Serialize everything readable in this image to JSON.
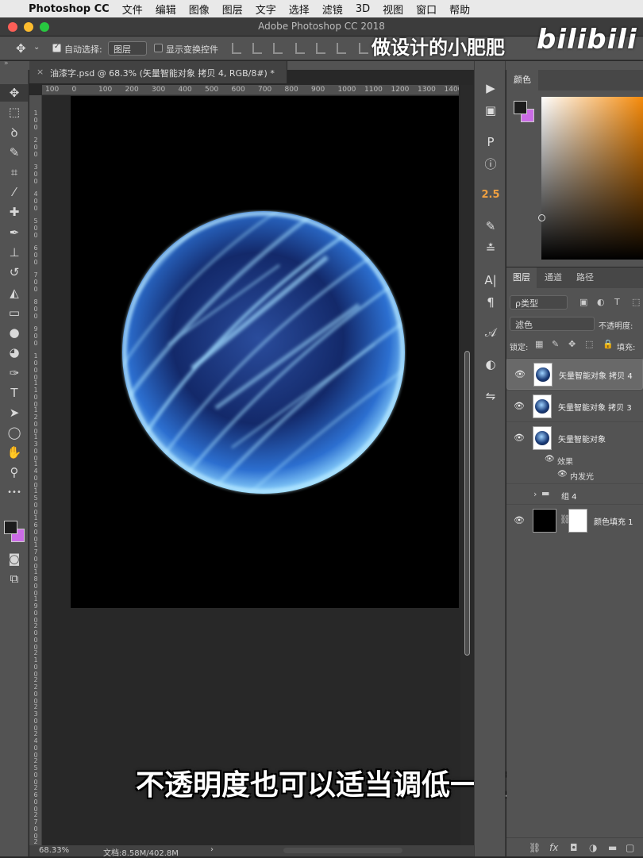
{
  "menubar": {
    "apple": "",
    "app_name": "Photoshop CC",
    "items": [
      "文件",
      "编辑",
      "图像",
      "图层",
      "文字",
      "选择",
      "滤镜",
      "3D",
      "视图",
      "窗口",
      "帮助"
    ]
  },
  "window": {
    "title": "Adobe Photoshop CC 2018"
  },
  "options_bar": {
    "auto_select_label": "自动选择:",
    "auto_select_checked": true,
    "auto_select_target": "图层",
    "show_transform_label": "显示变换控件",
    "show_transform_checked": false
  },
  "watermark": {
    "text": "做设计的小肥肥",
    "logo": "bilibili"
  },
  "document": {
    "tab_close": "×",
    "tab_title": "油漆字.psd @ 68.3% (矢量智能对象 拷贝 4, RGB/8#) *",
    "ruler_h": [
      "100",
      "0",
      "100",
      "200",
      "300",
      "400",
      "500",
      "600",
      "700",
      "800",
      "900",
      "1000",
      "1100",
      "1200",
      "1300",
      "1400"
    ],
    "ruler_v": [
      "100",
      "200",
      "300",
      "400",
      "500",
      "600",
      "700",
      "800",
      "900",
      "1000",
      "1100",
      "1200",
      "1300",
      "1400",
      "1500",
      "1600",
      "1700",
      "1800",
      "1900",
      "2000",
      "2100",
      "2200",
      "2300",
      "2400",
      "2500",
      "2600",
      "2700",
      "2800"
    ]
  },
  "subtitle": "不透明度也可以适当调低一点",
  "status": {
    "zoom": "68.33%",
    "doc_size": "文档:8.58M/402.8M",
    "arrow": "›"
  },
  "tools": [
    {
      "name": "move-tool",
      "glyph": "✥",
      "active": true
    },
    {
      "name": "marquee-tool",
      "glyph": "⬚"
    },
    {
      "name": "lasso-tool",
      "glyph": "ꝺ"
    },
    {
      "name": "quick-select-tool",
      "glyph": "✎"
    },
    {
      "name": "crop-tool",
      "glyph": "⌗"
    },
    {
      "name": "eyedropper-tool",
      "glyph": "⁄"
    },
    {
      "name": "healing-brush-tool",
      "glyph": "✚"
    },
    {
      "name": "brush-tool",
      "glyph": "✒"
    },
    {
      "name": "clone-stamp-tool",
      "glyph": "⊥"
    },
    {
      "name": "history-brush-tool",
      "glyph": "↺"
    },
    {
      "name": "eraser-tool",
      "glyph": "◭"
    },
    {
      "name": "gradient-tool",
      "glyph": "▭"
    },
    {
      "name": "blur-tool",
      "glyph": "●"
    },
    {
      "name": "dodge-tool",
      "glyph": "◕"
    },
    {
      "name": "pen-tool",
      "glyph": "✑"
    },
    {
      "name": "type-tool",
      "glyph": "T"
    },
    {
      "name": "path-select-tool",
      "glyph": "➤"
    },
    {
      "name": "ellipse-tool",
      "glyph": "◯"
    },
    {
      "name": "hand-tool",
      "glyph": "✋"
    },
    {
      "name": "zoom-tool",
      "glyph": "⚲"
    },
    {
      "name": "more-tools",
      "glyph": "•••"
    }
  ],
  "dock": [
    {
      "name": "play-icon",
      "glyph": "▶"
    },
    {
      "name": "navigator-icon",
      "glyph": "▣"
    },
    {
      "name": "properties-icon",
      "glyph": "P"
    },
    {
      "name": "info-icon",
      "glyph": "ⓘ"
    },
    {
      "name": "brush-size-label",
      "glyph": "2.5",
      "num": true
    },
    {
      "name": "brush-settings-icon",
      "glyph": "✎"
    },
    {
      "name": "adjust-icon",
      "glyph": "≛"
    },
    {
      "name": "character-icon",
      "glyph": "A|"
    },
    {
      "name": "paragraph-icon",
      "glyph": "¶"
    },
    {
      "name": "glyphs-icon",
      "glyph": "𝒜"
    },
    {
      "name": "adjustments-icon",
      "glyph": "◐"
    },
    {
      "name": "styles-icon",
      "glyph": "⇋"
    }
  ],
  "color_panel": {
    "tab": "颜色",
    "fg_color": "#1c1c1c",
    "bg_color": "#cb6ce6",
    "hue_color": "#f58a0a"
  },
  "layers_panel": {
    "tabs": [
      "图层",
      "通道",
      "路径"
    ],
    "filter_label": "ρ类型",
    "blend_mode": "滤色",
    "opacity_label": "不透明度:",
    "lock_label": "锁定:",
    "fill_label": "填充:",
    "layers": [
      {
        "name": "矢量智能对象 拷贝 4",
        "visible": true,
        "selected": true
      },
      {
        "name": "矢量智能对象 拷贝 3",
        "visible": true,
        "selected": false
      },
      {
        "name": "矢量智能对象",
        "visible": true,
        "selected": false
      }
    ],
    "effects_label": "效果",
    "inner_glow_label": "内发光",
    "group_name": "组 4",
    "fill_layer_name": "颜色填充 1",
    "bottom_icons": [
      "⛓",
      "fx",
      "◘",
      "◑",
      "▬",
      "▢",
      "🗑"
    ]
  }
}
